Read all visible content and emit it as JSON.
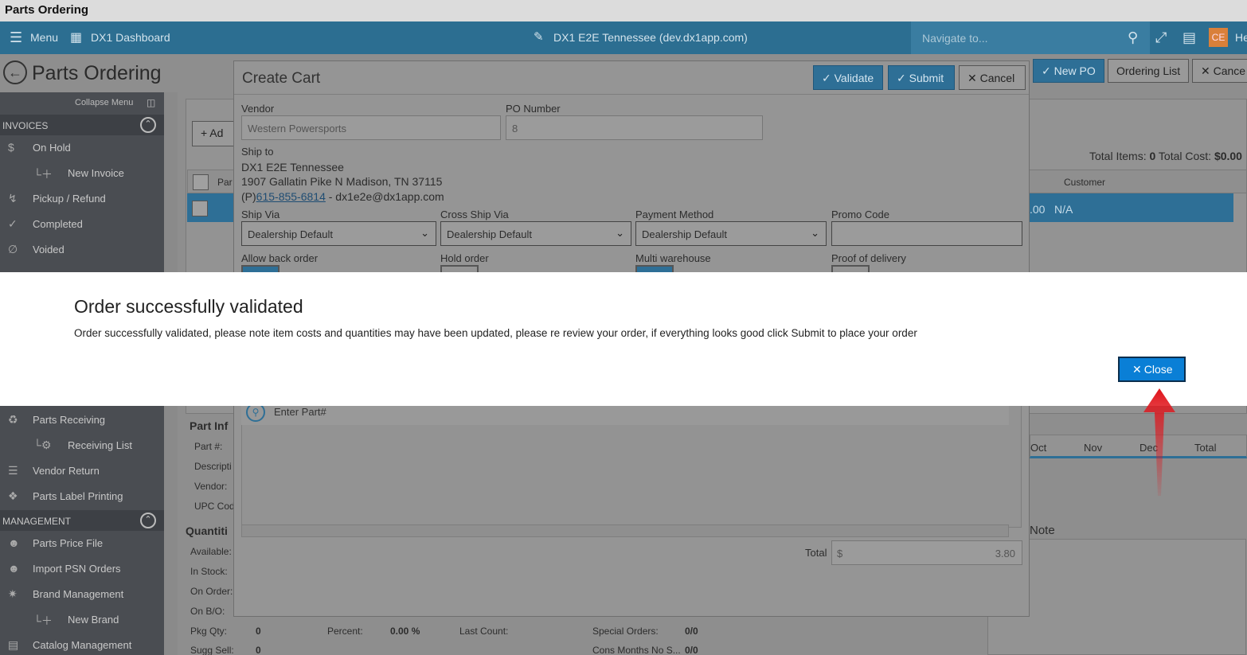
{
  "window": {
    "title": "Parts Ordering"
  },
  "appbar": {
    "menu_label": "Menu",
    "dashboard_label": "DX1 Dashboard",
    "site_label": "DX1 E2E Tennessee (dev.dx1app.com)",
    "navigate_placeholder": "Navigate to...",
    "avatar_initials": "CE",
    "help_label": "He"
  },
  "page": {
    "title": "Parts Ordering",
    "buttons": {
      "new_po": "New PO",
      "ordering_list": "Ordering List",
      "cancel": "Cance"
    },
    "add_label": "+ Ad",
    "totals_text": "Total Items: ",
    "total_items": "0",
    "total_cost_label": " Total Cost: ",
    "total_cost": "$0.00",
    "col_part": "Par",
    "col_customer": "Customer",
    "row_value": ".00",
    "row_customer": "N/A",
    "part_info": "Part Inf",
    "part_fields": [
      "Part #:",
      "Descripti",
      "Vendor:",
      "UPC Cod"
    ],
    "quantities": "Quantiti",
    "qty_fields": [
      "Available:",
      "In Stock:",
      "On Order:",
      "On B/O:"
    ],
    "pkg_qty_label": "Pkg Qty:",
    "pkg_qty": "0",
    "sugg_sell_label": "Sugg Sell:",
    "sugg_sell": "0",
    "percent_label": "Percent:",
    "percent": "0.00 %",
    "last_count_label": "Last Count:",
    "special_orders_label": "Special Orders:",
    "special_orders": "0/0",
    "cons_months_label": "Cons Months No S...",
    "cons_months": "0/0",
    "months": [
      "Oct",
      "Nov",
      "Dec",
      "Total"
    ],
    "note_label": "Note"
  },
  "sidebar": {
    "collapse_label": "Collapse Menu",
    "sections": {
      "invoices": "INVOICES",
      "management": "MANAGEMENT"
    },
    "invoice_items": [
      {
        "label": "On Hold",
        "icon": "dollar-icon"
      },
      {
        "label": "New Invoice",
        "icon": "plus-icon"
      },
      {
        "label": "Pickup / Refund",
        "icon": "pickup-icon"
      },
      {
        "label": "Completed",
        "icon": "check-icon"
      },
      {
        "label": "Voided",
        "icon": "voided-icon"
      }
    ],
    "inventory_items": [
      {
        "label": "Parts Receiving",
        "icon": "receiving-icon"
      },
      {
        "label": "Receiving List",
        "icon": "gear-icon"
      },
      {
        "label": "Vendor Return",
        "icon": "list-icon"
      },
      {
        "label": "Parts Label Printing",
        "icon": "tag-icon"
      }
    ],
    "management_items": [
      {
        "label": "Parts Price File",
        "icon": "users-icon"
      },
      {
        "label": "Import PSN Orders",
        "icon": "users-icon"
      },
      {
        "label": "Brand Management",
        "icon": "brand-icon"
      },
      {
        "label": "New Brand",
        "icon": "plus-icon"
      },
      {
        "label": "Catalog Management",
        "icon": "catalog-icon"
      }
    ]
  },
  "cart": {
    "title": "Create Cart",
    "validate_label": "Validate",
    "submit_label": "Submit",
    "cancel_label": "Cancel",
    "vendor_label": "Vendor",
    "vendor_value": "Western Powersports",
    "po_label": "PO Number",
    "po_value": "8",
    "ship_to_label": "Ship to",
    "ship_name": "DX1 E2E Tennessee",
    "ship_address": "1907 Gallatin Pike N Madison, TN 37115",
    "phone_prefix": "(P)",
    "phone": "615-855-6814",
    "email_suffix": " - dx1e2e@dx1app.com",
    "ship_via_label": "Ship Via",
    "ship_via_value": "Dealership Default",
    "cross_ship_label": "Cross Ship Via",
    "cross_ship_value": "Dealership Default",
    "payment_label": "Payment Method",
    "payment_value": "Dealership Default",
    "promo_label": "Promo Code",
    "promo_value": "",
    "allow_back_order_label": "Allow back order",
    "hold_order_label": "Hold order",
    "multi_warehouse_label": "Multi warehouse",
    "proof_delivery_label": "Proof of delivery",
    "part_search_placeholder": "Enter Part#",
    "total_label": "Total",
    "currency": "$",
    "total_value": "3.80"
  },
  "modal": {
    "title": "Order successfully validated",
    "message": "Order successfully validated, please note item costs and quantities may have been updated, please re review your order, if everything looks good click Submit to place your order",
    "close_label": "Close"
  },
  "colors": {
    "accent": "#0a7fd6",
    "appbar": "#2c6e91",
    "arrow": "#e0141b"
  }
}
